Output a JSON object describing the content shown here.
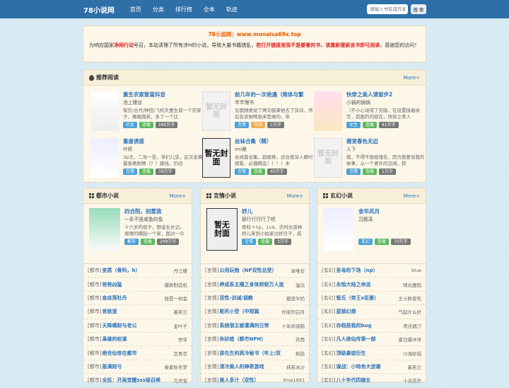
{
  "header": {
    "logo": "78小说网",
    "nav": [
      "首页",
      "分类",
      "排行榜",
      "全本",
      "轨迹"
    ],
    "search_placeholder": "请输入书名或作者",
    "search_button": "搜 索"
  },
  "notice": {
    "site": "78小说网：www.monaisa69x.top",
    "msg_start": "为响应国家",
    "red1": "净网行动",
    "msg_mid": "号召，本站清理了所有涉H的小说，导致大量书籍错乱，",
    "warn": "若打开链接发现不是要看的书，请重新搜索该书即可阅读",
    "msg_end": "，感谢您的访问！"
  },
  "recommend": {
    "title": "推荐阅读",
    "more": "More+",
    "books": [
      {
        "title": "重生农家致富抖音",
        "author": "池上棲台",
        "desc": "架空/古代/种田/飞机夫妻生成一个农家子，瘫痪圆弟，多了一个比",
        "tags": [
          "历史",
          "连载",
          "160万字"
        ],
        "cover": "重生农家致富抖音"
      },
      {
        "title": "前几年的一次艳遇（简体与繁",
        "author": "芊芊理书",
        "desc": "见面随便说了两句鼓掌他去了房间，然后告诉她喝张床是她的，带",
        "tags": [
          "言情",
          "完结",
          "1万字"
        ],
        "cover": "暂无封面"
      },
      {
        "title": "快穿之美人请留步2",
        "author": "小锅的锅锅",
        "desc": "（不小心误成了究级，在设置接着续写，前面的内容在，快穿之美人",
        "tags": [
          "女生",
          "连载",
          "41万字"
        ],
        "cover": "美人请留步"
      },
      {
        "title": "重度诱惑",
        "author": "叶昕",
        "desc": "3p文，二攻一受，爷们儿受，这次走黄暴香艳剧情（？）路线，仍旧",
        "tags": [
          "言情",
          "连载",
          "39万字"
        ],
        "cover": "猫片绿佛中"
      },
      {
        "title": "丝袜合集（精）",
        "author": "imi桑",
        "desc": "丝袜篇合集，超级爽，适合夜深人静时观看，必撸精品！！！！本",
        "tags": [
          "言情",
          "连载",
          "40万字"
        ],
        "cover": "暂无封面"
      },
      {
        "title": "寝室春色无边",
        "author": "人下",
        "desc": "我，不得不隐姓埋名，因为我要说我的故事，从一个意外的见闻，转",
        "tags": [
          "言情",
          "连载",
          "1万字"
        ],
        "cover": "暂无封面"
      }
    ]
  },
  "columns": [
    {
      "title": "都市小说",
      "more": "More+",
      "feat": {
        "title": "四合院，别惹我",
        "author": "一条不是咸鱼的鱼",
        "desc": "十六岁的孩子，野蛮生长记。艰难的撑起一个家，面对一众",
        "tags": [
          "都市",
          "连载",
          "299万字"
        ]
      },
      "items": [
        [
          "[都市]",
          "变质（骨科，h）",
          "丹江樱"
        ],
        [
          "[都市]",
          "爸爸凶猛",
          "爆款制造机"
        ],
        [
          "[都市]",
          "金丝笼牡丹",
          "琵琶一树金"
        ],
        [
          "[都市]",
          "官欲道",
          "墨若兰"
        ],
        [
          "[都市]",
          "天降横财与老公",
          "金叶子"
        ],
        [
          "[都市]",
          "枭雄的权谋",
          "悟爷"
        ],
        [
          "[都市]",
          "绝世仙帝在都市",
          "恋青衣"
        ],
        [
          "[都市]",
          "盈满则亏",
          "春夏秋冬梦"
        ],
        [
          "[都市]",
          "全民：开局觉醒sss级召唤",
          "万灵宝"
        ]
      ]
    },
    {
      "title": "言情小说",
      "more": "More+",
      "feat": {
        "title": "妤儿",
        "author": "那行行行行了吧",
        "desc": "骨科＋np，1v4，农村女孩林妤儿来到小姑家过好日子，成",
        "tags": [
          "言情",
          "连载",
          "3万字"
        ]
      },
      "items": [
        [
          "[言情]",
          "公用玩物（NP双性总受）",
          "单唯安"
        ],
        [
          "[言情]",
          "养成系主播之身体娇软万人迷",
          "温沅"
        ],
        [
          "[言情]",
          "双性-训诫/调教",
          "楹莲牛奶"
        ],
        [
          "[言情]",
          "乾死小受（中短篇",
          "你家的白月"
        ],
        [
          "[言情]",
          "系统宿主被灌满的日常",
          "十年修成鹅"
        ],
        [
          "[言情]",
          "朱砂痣（都市NPH）",
          "苏西"
        ],
        [
          "[言情]",
          "邵先生的高冷秘书（年上/双",
          "荆陆"
        ],
        [
          "[言情]",
          "清冷美人的神奇游戏",
          "抹茶冰沙"
        ],
        [
          "[言情]",
          "美人多汁（双性）",
          "fmw1991"
        ]
      ]
    },
    {
      "title": "玄幻小说",
      "more": "More+",
      "feat": {
        "title": "金华风月",
        "author": "沉檀凑",
        "desc": "",
        "tags": [
          "玄幻",
          "连载",
          "70万字"
        ]
      },
      "items": [
        [
          "[玄幻]",
          "圣母的下场（np）",
          "blue"
        ],
        [
          "[玄幻]",
          "永恒大陆之命运",
          "晴光魔阳"
        ],
        [
          "[玄幻]",
          "皙氏（帝王x臣妻）",
          "王小胖爱吃"
        ],
        [
          "[玄幻]",
          "蓝锁幻想",
          "气起什么好"
        ],
        [
          "[玄幻]",
          "存档是我的bug",
          "鸢点烟汀"
        ],
        [
          "[玄幻]",
          "凡人修仙传第一部",
          "夏日爆冲洋"
        ],
        [
          "[玄幻]",
          "顶级暴徒衍生",
          "川海砂锅"
        ],
        [
          "[玄幻]",
          "谋战：小特务大逆袭",
          "墨若兰"
        ],
        [
          "[玄幻]",
          "八十年代四嫁女",
          "十点花开"
        ]
      ]
    }
  ]
}
